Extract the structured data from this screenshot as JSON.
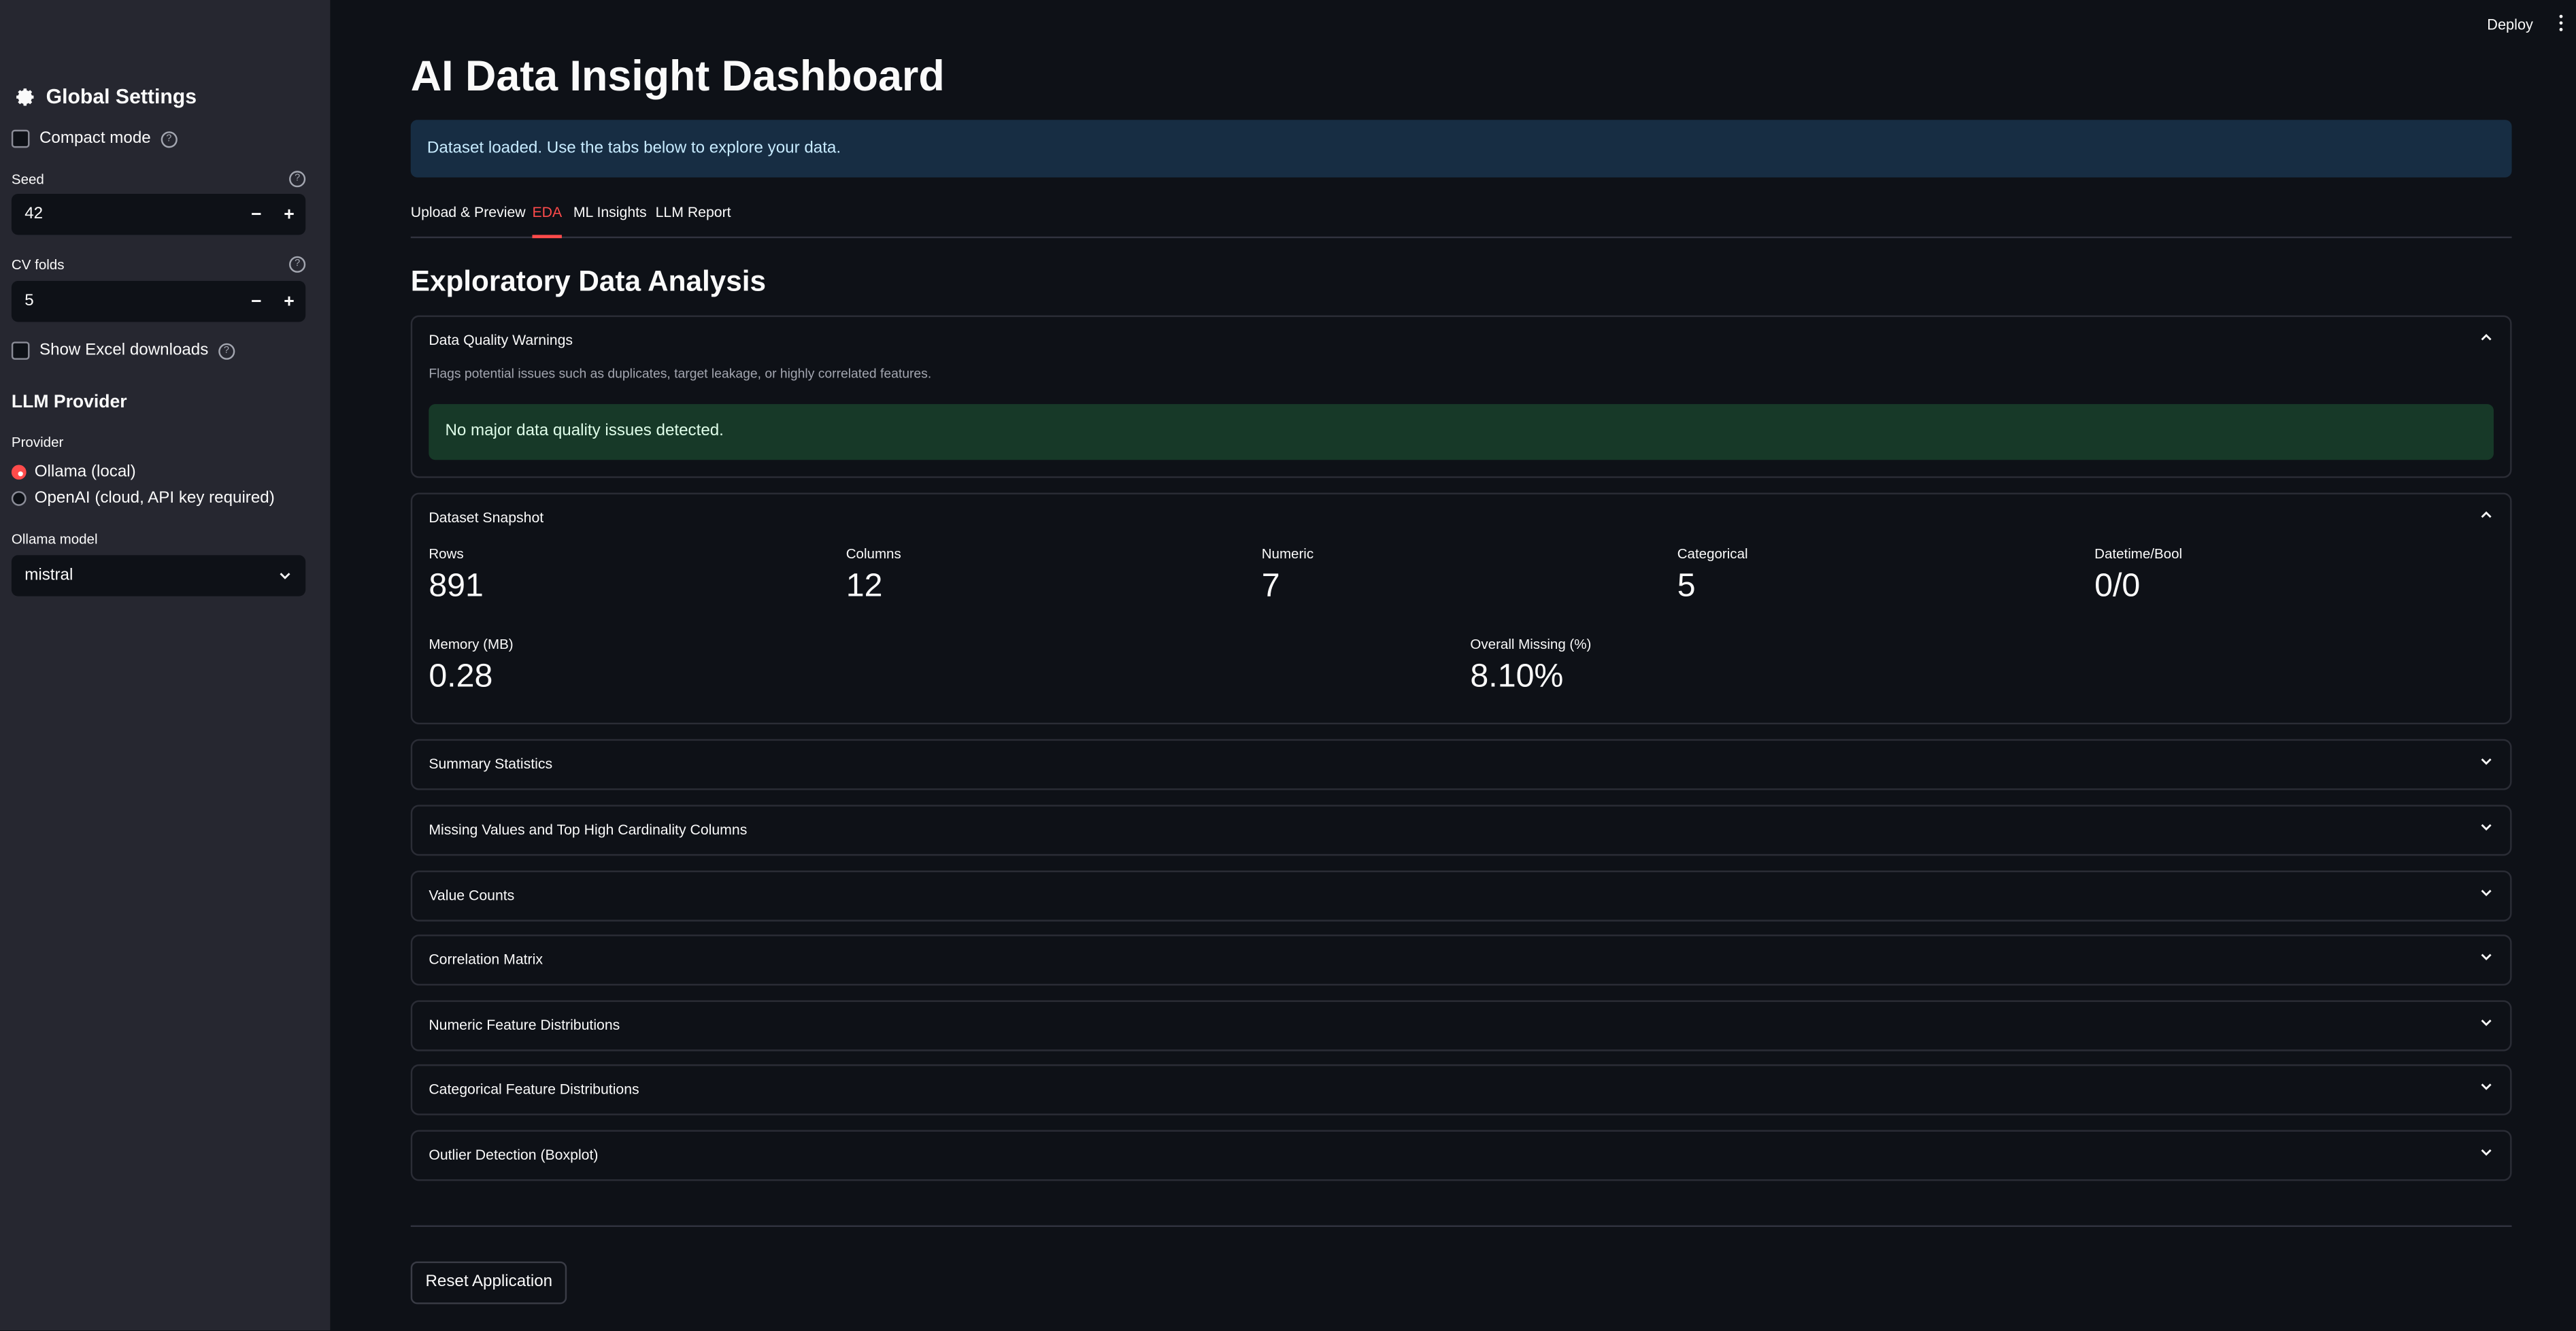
{
  "sidebar": {
    "heading": "Global Settings",
    "compact_mode_label": "Compact mode",
    "seed_label": "Seed",
    "seed_value": "42",
    "cv_folds_label": "CV folds",
    "cv_folds_value": "5",
    "excel_label": "Show Excel downloads",
    "llm_heading": "LLM Provider",
    "provider_label": "Provider",
    "provider_options": [
      "Ollama (local)",
      "OpenAI (cloud, API key required)"
    ],
    "provider_selected": "Ollama (local)",
    "ollama_model_label": "Ollama model",
    "ollama_model_value": "mistral"
  },
  "topbar": {
    "deploy_label": "Deploy"
  },
  "main": {
    "title": "AI Data Insight Dashboard",
    "info_message": "Dataset loaded. Use the tabs below to explore your data.",
    "tabs": [
      "Upload & Preview",
      "EDA",
      "ML Insights",
      "LLM Report"
    ],
    "active_tab": "EDA",
    "section_title": "Exploratory Data Analysis",
    "quality": {
      "title": "Data Quality Warnings",
      "caption": "Flags potential issues such as duplicates, target leakage, or highly correlated features.",
      "message": "No major data quality issues detected."
    },
    "snapshot": {
      "title": "Dataset Snapshot",
      "metrics_row1": [
        {
          "label": "Rows",
          "value": "891"
        },
        {
          "label": "Columns",
          "value": "12"
        },
        {
          "label": "Numeric",
          "value": "7"
        },
        {
          "label": "Categorical",
          "value": "5"
        },
        {
          "label": "Datetime/Bool",
          "value": "0/0"
        }
      ],
      "metrics_row2": [
        {
          "label": "Memory (MB)",
          "value": "0.28"
        },
        {
          "label": "Overall Missing (%)",
          "value": "8.10%"
        }
      ]
    },
    "collapsed_sections": [
      "Summary Statistics",
      "Missing Values and Top High Cardinality Columns",
      "Value Counts",
      "Correlation Matrix",
      "Numeric Feature Distributions",
      "Categorical Feature Distributions",
      "Outlier Detection (Boxplot)"
    ],
    "reset_label": "Reset Application"
  },
  "colors": {
    "accent": "#ff4b4b",
    "background": "#0e1117",
    "sidebar": "#262730",
    "info_bg": "#172d43",
    "success_bg": "#173928"
  }
}
